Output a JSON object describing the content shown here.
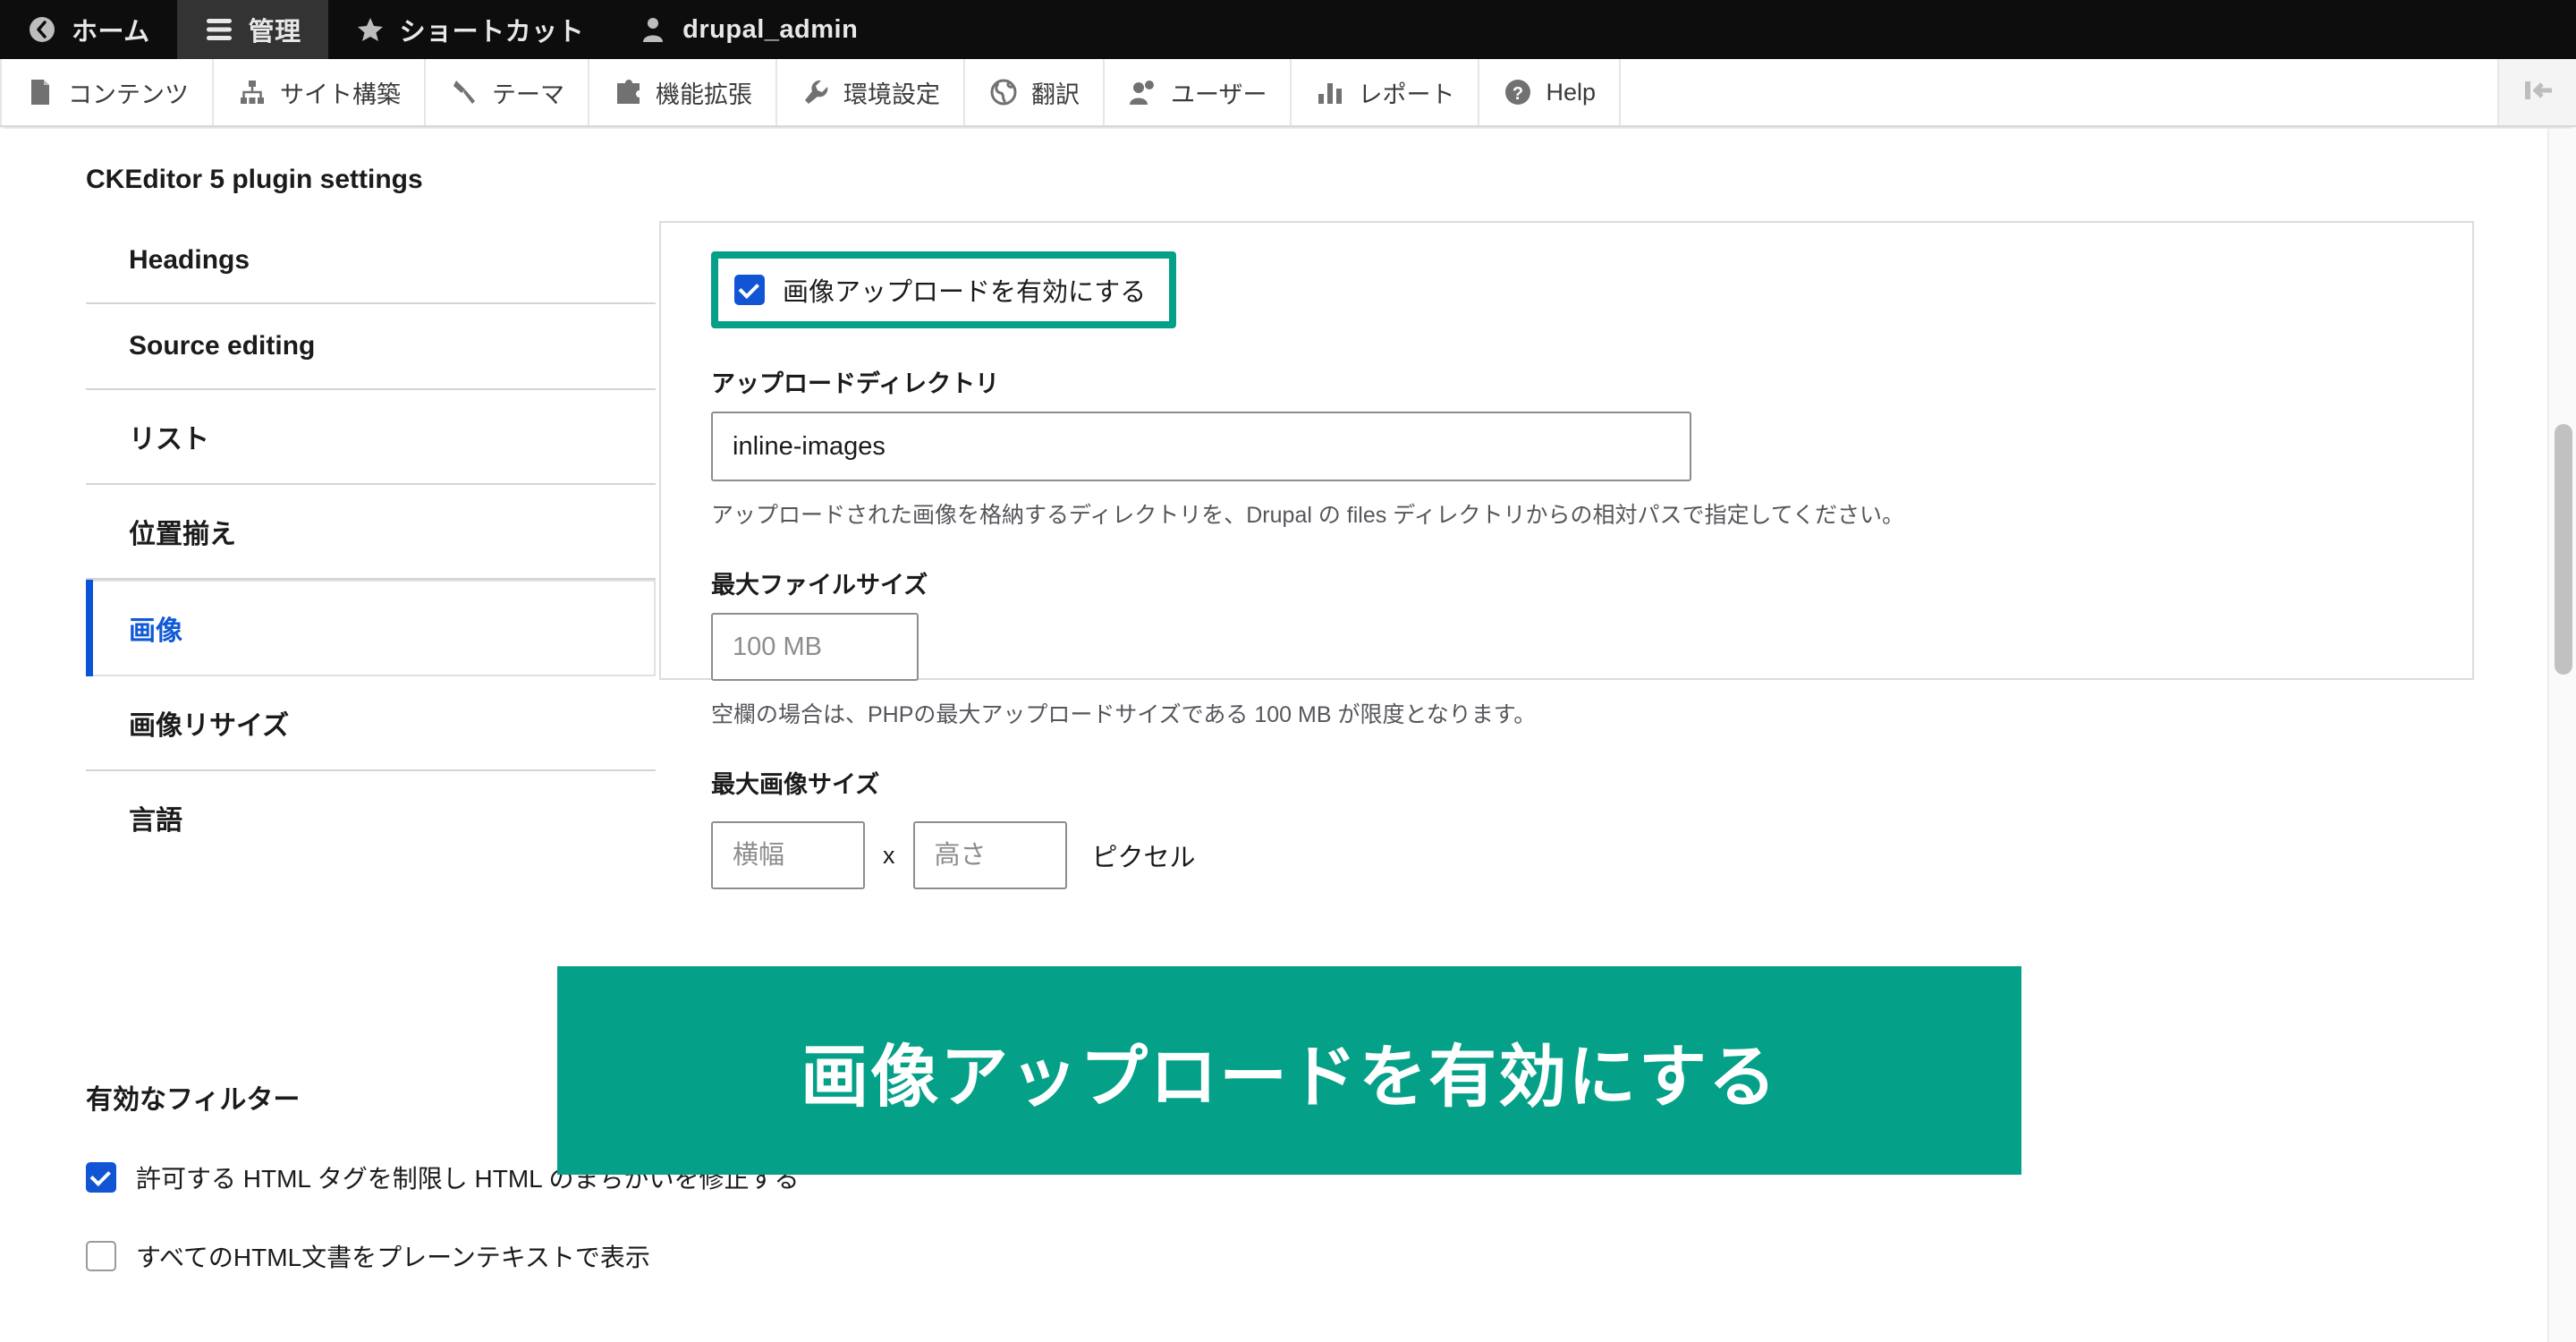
{
  "toolbar": {
    "items": [
      {
        "label": "ホーム",
        "icon": "back-circle-icon",
        "active": false
      },
      {
        "label": "管理",
        "icon": "hamburger-icon",
        "active": true
      },
      {
        "label": "ショートカット",
        "icon": "star-icon",
        "active": false
      },
      {
        "label": "drupal_admin",
        "icon": "user-icon",
        "active": false
      }
    ]
  },
  "menu": {
    "items": [
      {
        "label": "コンテンツ",
        "icon": "file-icon"
      },
      {
        "label": "サイト構築",
        "icon": "sitemap-icon"
      },
      {
        "label": "テーマ",
        "icon": "brush-icon"
      },
      {
        "label": "機能拡張",
        "icon": "puzzle-icon"
      },
      {
        "label": "環境設定",
        "icon": "wrench-icon"
      },
      {
        "label": "翻訳",
        "icon": "globe-icon"
      },
      {
        "label": "ユーザー",
        "icon": "people-icon"
      },
      {
        "label": "レポート",
        "icon": "bar-chart-icon"
      },
      {
        "label": "Help",
        "icon": "question-circle-icon"
      }
    ],
    "collapse_icon": "collapse-toolbar-icon"
  },
  "page": {
    "heading": "CKEditor 5 plugin settings"
  },
  "vertical_tabs": [
    {
      "label": "Headings",
      "active": false
    },
    {
      "label": "Source editing",
      "active": false
    },
    {
      "label": "リスト",
      "active": false
    },
    {
      "label": "位置揃え",
      "active": false
    },
    {
      "label": "画像",
      "active": true
    },
    {
      "label": "画像リサイズ",
      "active": false
    },
    {
      "label": "言語",
      "active": false
    }
  ],
  "image_settings": {
    "enable_upload": {
      "label": "画像アップロードを有効にする",
      "checked": true,
      "highlight_color": "#04a088"
    },
    "upload_directory": {
      "label": "アップロードディレクトリ",
      "value": "inline-images",
      "placeholder": "",
      "description": "アップロードされた画像を格納するディレクトリを、Drupal の files ディレクトリからの相対パスで指定してください。"
    },
    "max_file_size": {
      "label": "最大ファイルサイズ",
      "value": "",
      "placeholder": "100 MB",
      "description": "空欄の場合は、PHPの最大アップロードサイズである 100 MB が限度となります。"
    },
    "max_image_size": {
      "label": "最大画像サイズ",
      "width_placeholder": "横幅",
      "height_placeholder": "高さ",
      "width_value": "",
      "height_value": "",
      "separator": "x",
      "unit": "ピクセル"
    }
  },
  "filters": {
    "title": "有効なフィルター",
    "items": [
      {
        "label": "許可する HTML タグを制限し HTML のまちがいを修正する",
        "checked": true
      },
      {
        "label": "すべてのHTML文書をプレーンテキストで表示",
        "checked": false
      }
    ]
  },
  "callout_banner": {
    "text": "画像アップロードを有効にする",
    "background": "#04a088",
    "text_color": "#ffffff"
  }
}
